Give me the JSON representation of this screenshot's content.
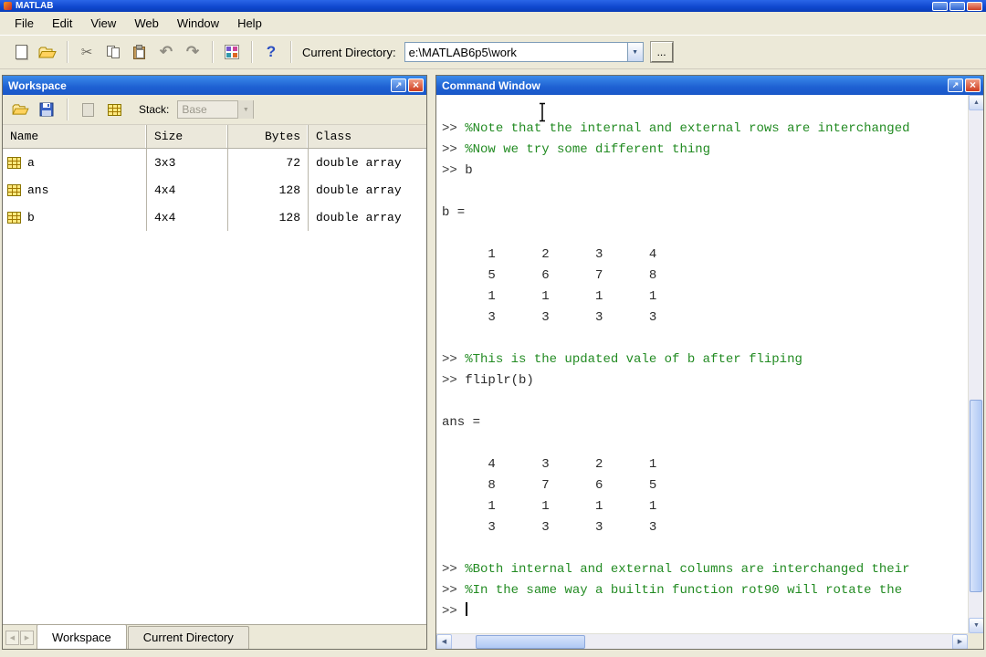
{
  "titlebar": {
    "title": "MATLAB"
  },
  "menubar": {
    "items": [
      "File",
      "Edit",
      "View",
      "Web",
      "Window",
      "Help"
    ]
  },
  "toolbar": {
    "glyphs": {
      "cut": "✂",
      "undo": "↶",
      "redo": "↷",
      "help": "?",
      "combo_arrow": "▼",
      "browse": "..."
    },
    "current_directory_label": "Current Directory:",
    "current_directory_value": "e:\\MATLAB6p5\\work"
  },
  "workspace": {
    "title": "Workspace",
    "titlebar_buttons": {
      "restore": "↗",
      "close": "×"
    },
    "stack_label": "Stack:",
    "stack_value": "Base",
    "columns": {
      "name": "Name",
      "size": "Size",
      "bytes": "Bytes",
      "class": "Class"
    },
    "rows": [
      {
        "name": "a",
        "size": "3x3",
        "bytes": "72",
        "class": "double array"
      },
      {
        "name": "ans",
        "size": "4x4",
        "bytes": "128",
        "class": "double array"
      },
      {
        "name": "b",
        "size": "4x4",
        "bytes": "128",
        "class": "double array"
      }
    ],
    "tabs": [
      {
        "label": "Workspace",
        "active": true
      },
      {
        "label": "Current Directory",
        "active": false
      }
    ],
    "tab_arrows": {
      "left": "◀",
      "right": "▶"
    }
  },
  "command_window": {
    "title": "Command Window",
    "titlebar_buttons": {
      "restore": "↗",
      "close": "×"
    },
    "scroll_glyphs": {
      "up": "▲",
      "down": "▼",
      "left": "◀",
      "right": "▶"
    },
    "lines": [
      {
        "kind": "comment",
        "prompt": ">> ",
        "text": "%Note that the internal and external rows are interchanged"
      },
      {
        "kind": "comment",
        "prompt": ">> ",
        "text": "%Now we try some different thing"
      },
      {
        "kind": "code",
        "prompt": ">> ",
        "text": "b"
      },
      {
        "kind": "output",
        "prompt": "",
        "text": ""
      },
      {
        "kind": "output",
        "prompt": "",
        "text": "b ="
      },
      {
        "kind": "output",
        "prompt": "",
        "text": ""
      },
      {
        "kind": "output",
        "prompt": "",
        "text": "      1      2      3      4"
      },
      {
        "kind": "output",
        "prompt": "",
        "text": "      5      6      7      8"
      },
      {
        "kind": "output",
        "prompt": "",
        "text": "      1      1      1      1"
      },
      {
        "kind": "output",
        "prompt": "",
        "text": "      3      3      3      3"
      },
      {
        "kind": "output",
        "prompt": "",
        "text": ""
      },
      {
        "kind": "comment",
        "prompt": ">> ",
        "text": "%This is the updated vale of b after fliping"
      },
      {
        "kind": "code",
        "prompt": ">> ",
        "text": "fliplr(b)"
      },
      {
        "kind": "output",
        "prompt": "",
        "text": ""
      },
      {
        "kind": "output",
        "prompt": "",
        "text": "ans ="
      },
      {
        "kind": "output",
        "prompt": "",
        "text": ""
      },
      {
        "kind": "output",
        "prompt": "",
        "text": "      4      3      2      1"
      },
      {
        "kind": "output",
        "prompt": "",
        "text": "      8      7      6      5"
      },
      {
        "kind": "output",
        "prompt": "",
        "text": "      1      1      1      1"
      },
      {
        "kind": "output",
        "prompt": "",
        "text": "      3      3      3      3"
      },
      {
        "kind": "output",
        "prompt": "",
        "text": ""
      },
      {
        "kind": "comment",
        "prompt": ">> ",
        "text": "%Both internal and external columns are interchanged their"
      },
      {
        "kind": "comment",
        "prompt": ">> ",
        "text": "%In the same way a builtin function rot90 will rotate the"
      },
      {
        "kind": "code",
        "prompt": ">> ",
        "text": "",
        "caret": true
      }
    ]
  }
}
